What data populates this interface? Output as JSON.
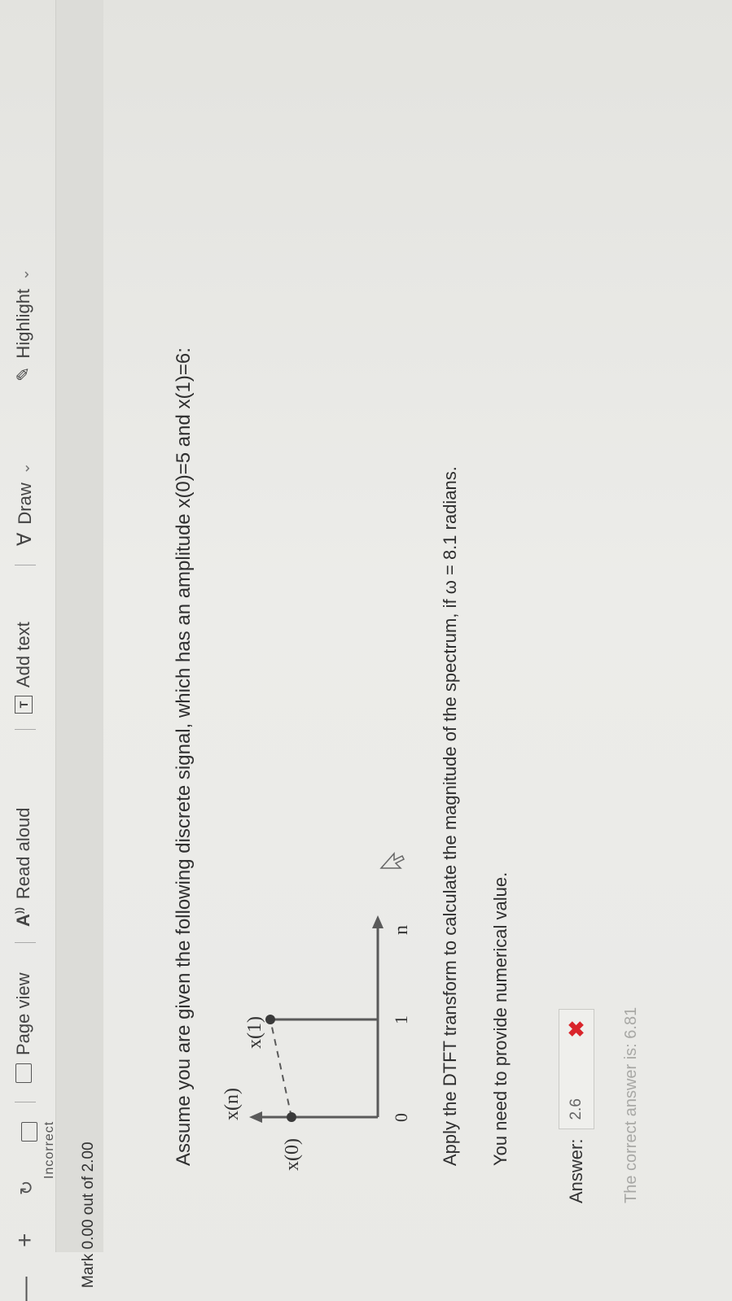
{
  "toolbar": {
    "minimize": "—",
    "zoom_in": "+",
    "page_view": "Page view",
    "read_aloud": "Read aloud",
    "add_text": "Add text",
    "draw": "Draw",
    "highlight": "Highlight",
    "dropdown_glyph": "⌄"
  },
  "status": {
    "feedback_cut": "Incorrect",
    "mark": "Mark 0.00 out of 2.00"
  },
  "question": {
    "intro": "Assume you are given the following discrete signal, which has an  amplitude x(0)=5 and x(1)=6:",
    "instruction": "Apply the DTFT transform to calculate the magnitude of the spectrum, if ω = 8.1 radians.",
    "note": "You need to provide numerical value."
  },
  "figure": {
    "y_axis_label": "x(n)",
    "x_axis_label": "n",
    "point0_label": "x(0)",
    "point1_label": "x(1)",
    "tick0": "0",
    "tick1": "1"
  },
  "answer": {
    "label": "Answer:",
    "value": "2.6",
    "correct_text": "The correct answer is: 6.81"
  }
}
